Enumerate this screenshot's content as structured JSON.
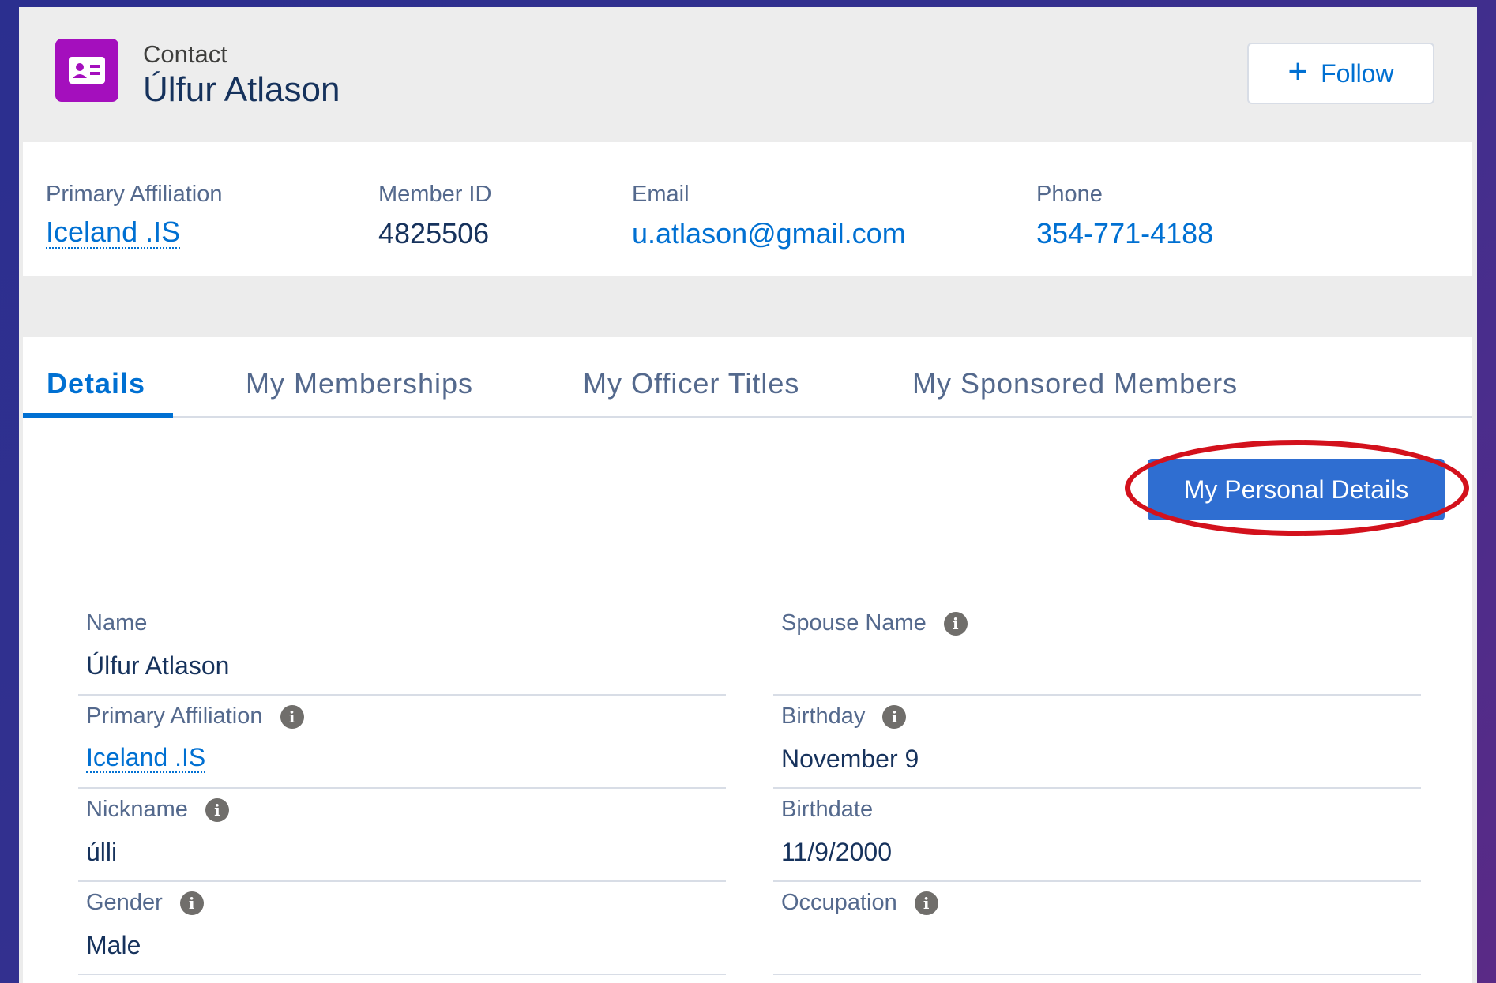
{
  "header": {
    "object_type": "Contact",
    "title": "Úlfur Atlason",
    "follow_label": "Follow",
    "follow_icon": "plus-icon",
    "object_icon": "contact-card-icon"
  },
  "highlights": {
    "primary_affiliation": {
      "label": "Primary Affiliation",
      "value": "Iceland .IS"
    },
    "member_id": {
      "label": "Member ID",
      "value": "4825506"
    },
    "email": {
      "label": "Email",
      "value": "u.atlason@gmail.com"
    },
    "phone": {
      "label": "Phone",
      "value": "354-771-4188"
    }
  },
  "tabs": [
    {
      "label": "Details",
      "active": true
    },
    {
      "label": "My Memberships",
      "active": false
    },
    {
      "label": "My Officer Titles",
      "active": false
    },
    {
      "label": "My Sponsored Members",
      "active": false
    }
  ],
  "personal_details_button": "My Personal Details",
  "annotation": {
    "highlight_color": "#d3111c"
  },
  "fields": {
    "left": [
      {
        "label": "Name",
        "value": "Úlfur Atlason",
        "info": false,
        "link": false
      },
      {
        "label": "Primary Affiliation",
        "value": "Iceland .IS",
        "info": true,
        "link": true
      },
      {
        "label": "Nickname",
        "value": "úlli",
        "info": true,
        "link": false
      },
      {
        "label": "Gender",
        "value": "Male",
        "info": true,
        "link": false
      }
    ],
    "right": [
      {
        "label": "Spouse Name",
        "value": "",
        "info": true,
        "link": false
      },
      {
        "label": "Birthday",
        "value": "November 9",
        "info": true,
        "link": false
      },
      {
        "label": "Birthdate",
        "value": "11/9/2000",
        "info": false,
        "link": false
      },
      {
        "label": "Occupation",
        "value": "",
        "info": true,
        "link": false
      }
    ]
  },
  "colors": {
    "brand_blue": "#0070d2",
    "contact_icon_bg": "#a40fbd",
    "button_blue": "#2f6ed1"
  }
}
